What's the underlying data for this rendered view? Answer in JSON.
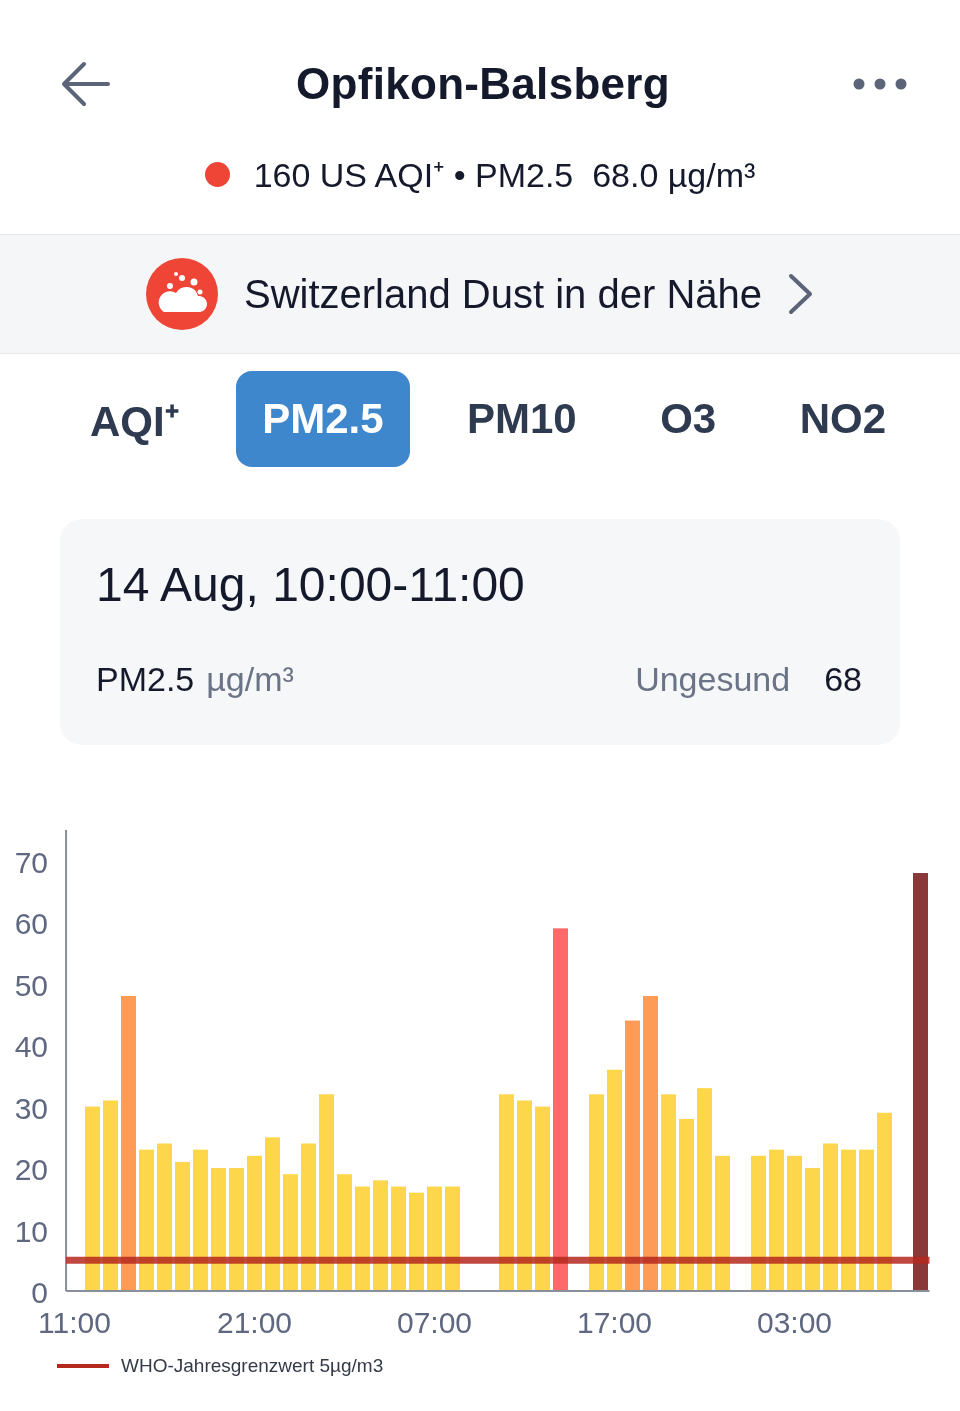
{
  "header": {
    "title": "Opfikon-Balsberg",
    "status_dot": {
      "color": "#ef4537"
    },
    "summary": "160 US AQI⁺ • PM2.5  68.0 µg/m³"
  },
  "banner": {
    "text": "Switzerland Dust in der Nähe"
  },
  "tabs": [
    {
      "label": "AQI⁺",
      "selected": false
    },
    {
      "label": "PM2.5",
      "selected": true
    },
    {
      "label": "PM10",
      "selected": false
    },
    {
      "label": "O3",
      "selected": false
    },
    {
      "label": "NO2",
      "selected": false
    }
  ],
  "detail_card": {
    "title": "14 Aug, 10:00-11:00",
    "pollutant": "PM2.5",
    "unit": "µg/m³",
    "status": "Ungesund",
    "value": "68"
  },
  "chart": {
    "chart_data": {
      "type": "bar",
      "categories": [
        "11:00",
        null,
        null,
        null,
        null,
        null,
        null,
        null,
        null,
        null,
        "21:00",
        null,
        null,
        null,
        null,
        null,
        null,
        null,
        null,
        null,
        "07:00",
        null,
        null,
        null,
        null,
        null,
        null,
        null,
        null,
        null,
        "17:00",
        null,
        null,
        null,
        null,
        null,
        null,
        null,
        null,
        null,
        "03:00",
        null,
        null,
        null,
        null,
        null,
        null,
        null
      ],
      "series": [
        {
          "color": "#fdd64b",
          "values": [
            null,
            30,
            31,
            null,
            23,
            24,
            21,
            23,
            20,
            20,
            22,
            25,
            19,
            24,
            32,
            19,
            17,
            18,
            17,
            16,
            17,
            17,
            null,
            null,
            32,
            31,
            30,
            null,
            null,
            32,
            36,
            null,
            null,
            32,
            28,
            33,
            22,
            null,
            22,
            23,
            22,
            20,
            24,
            23,
            23,
            29,
            null,
            null
          ]
        },
        {
          "color": "#fe9b57",
          "values": [
            null,
            null,
            null,
            48,
            null,
            null,
            null,
            null,
            null,
            null,
            null,
            null,
            null,
            null,
            null,
            null,
            null,
            null,
            null,
            null,
            null,
            null,
            null,
            null,
            null,
            null,
            null,
            null,
            null,
            null,
            null,
            44,
            48,
            null,
            null,
            null,
            null,
            null,
            null,
            null,
            null,
            null,
            null,
            null,
            null,
            null,
            null,
            null
          ]
        },
        {
          "color": "#fe6a69",
          "values": [
            null,
            null,
            null,
            null,
            null,
            null,
            null,
            null,
            null,
            null,
            null,
            null,
            null,
            null,
            null,
            null,
            null,
            null,
            null,
            null,
            null,
            null,
            null,
            null,
            null,
            null,
            null,
            59,
            null,
            null,
            null,
            null,
            null,
            null,
            null,
            null,
            null,
            null,
            null,
            null,
            null,
            null,
            null,
            null,
            null,
            null,
            null,
            null
          ]
        },
        {
          "color": "#8a3838",
          "values": [
            null,
            null,
            null,
            null,
            null,
            null,
            null,
            null,
            null,
            null,
            null,
            null,
            null,
            null,
            null,
            null,
            null,
            null,
            null,
            null,
            null,
            null,
            null,
            null,
            null,
            null,
            null,
            null,
            null,
            null,
            null,
            null,
            null,
            null,
            null,
            null,
            null,
            null,
            null,
            null,
            null,
            null,
            null,
            null,
            null,
            null,
            null,
            68
          ]
        }
      ],
      "ylim": [
        0,
        75
      ],
      "yticks": [
        0,
        10,
        20,
        30,
        40,
        50,
        60,
        70
      ],
      "ref_lines": [
        {
          "axis": "y",
          "value": 5,
          "color": "#b5281e",
          "label": "WHO-Jahresgrenzwert 5µg/m3"
        }
      ]
    }
  }
}
